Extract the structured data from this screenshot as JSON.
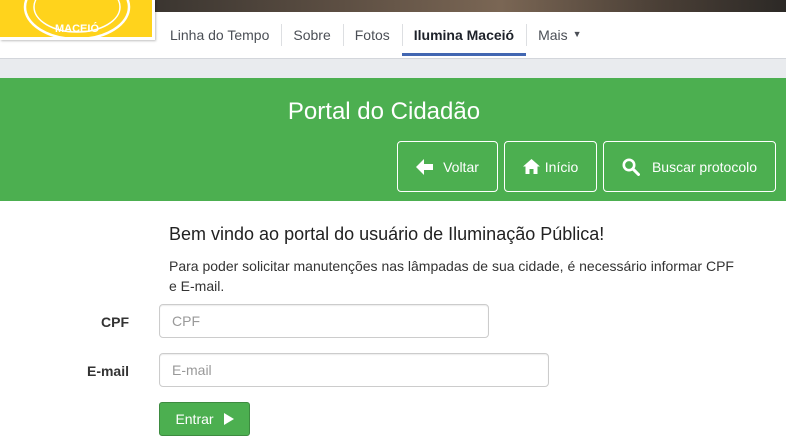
{
  "facebook": {
    "tabs": [
      {
        "label": "Linha do Tempo",
        "active": false
      },
      {
        "label": "Sobre",
        "active": false
      },
      {
        "label": "Fotos",
        "active": false
      },
      {
        "label": "Ilumina Maceió",
        "active": true
      },
      {
        "label": "Mais",
        "active": false
      }
    ],
    "profile_text": "MACEIÓ",
    "active_tab_color": "#4267b2",
    "profile_color": "#ffd31c"
  },
  "portal": {
    "title": "Portal do Cidadão",
    "nav": {
      "voltar": "Voltar",
      "inicio": "Início",
      "buscar": "Buscar protocolo"
    },
    "accent_color": "#4caf50"
  },
  "content": {
    "welcome": "Bem vindo ao portal do usuário de Iluminação Pública!",
    "info": "Para poder solicitar manutenções nas lâmpadas de sua cidade, é necessário informar CPF e E-mail.",
    "cpf_label": "CPF",
    "cpf_placeholder": "CPF",
    "email_label": "E-mail",
    "email_placeholder": "E-mail",
    "submit_label": "Entrar"
  },
  "icons": {
    "voltar": "arrow-left-icon",
    "inicio": "home-icon",
    "buscar": "search-icon",
    "entrar": "play-icon"
  }
}
